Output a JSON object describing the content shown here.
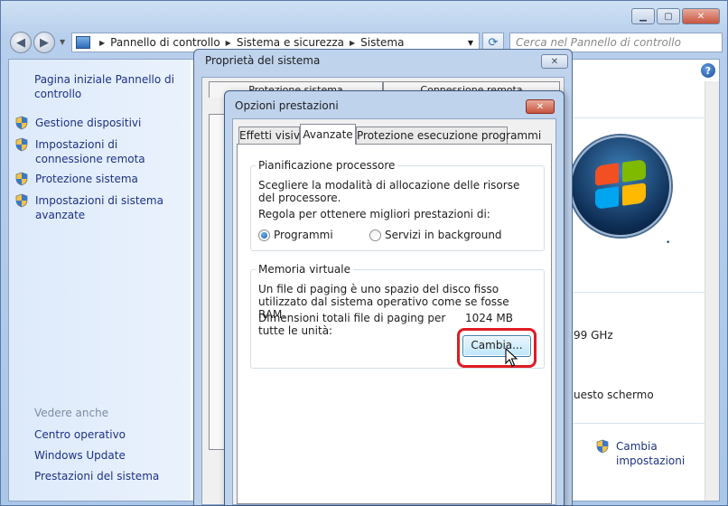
{
  "main_window": {
    "address": {
      "crumbs": [
        "Pannello di controllo",
        "Sistema e sicurezza",
        "Sistema"
      ],
      "search_placeholder": "Cerca nel Pannello di controllo"
    },
    "left_pane": {
      "home_link": "Pagina iniziale Pannello di controllo",
      "tasks": [
        {
          "label": "Gestione dispositivi",
          "icon": "uac-shield-icon"
        },
        {
          "label": "Impostazioni di connessione remota",
          "icon": "uac-shield-icon"
        },
        {
          "label": "Protezione sistema",
          "icon": "uac-shield-icon"
        },
        {
          "label": "Impostazioni di sistema avanzate",
          "icon": "uac-shield-icon"
        }
      ],
      "see_also_heading": "Vedere anche",
      "see_also": [
        "Centro operativo",
        "Windows Update",
        "Prestazioni del sistema"
      ]
    },
    "right_pane": {
      "cpu_fragment": "99 GHz",
      "display_fragment": "uesto schermo",
      "change_settings": "Cambia impostazioni"
    }
  },
  "system_properties": {
    "title": "Proprietà del sistema",
    "tabs": [
      "Protezione sistema",
      "Connessione remota"
    ]
  },
  "performance_options": {
    "title": "Opzioni prestazioni",
    "tabs": [
      "Effetti visivi",
      "Avanzate",
      "Protezione esecuzione programmi"
    ],
    "active_tab": "Avanzate",
    "cpu_group": {
      "title": "Pianificazione processore",
      "description": "Scegliere la modalità di allocazione delle risorse del processore.",
      "prompt": "Regola per ottenere migliori prestazioni di:",
      "options": [
        {
          "label": "Programmi",
          "selected": true
        },
        {
          "label": "Servizi in background",
          "selected": false
        }
      ]
    },
    "vm_group": {
      "title": "Memoria virtuale",
      "description": "Un file di paging è uno spazio del disco fisso utilizzato dal sistema operativo come se fosse RAM.",
      "size_label": "Dimensioni totali file di paging per tutte le unità:",
      "size_value": "1024 MB",
      "change_button": "Cambia..."
    }
  },
  "colors": {
    "link": "#1e3287",
    "highlight": "#e01b24",
    "glass": "#bfd3ec"
  }
}
